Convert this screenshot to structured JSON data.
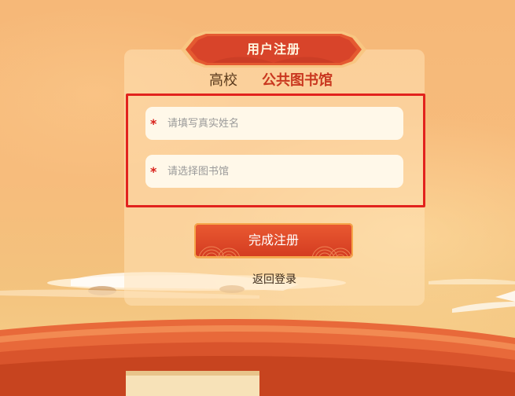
{
  "banner": {
    "title": "用户注册"
  },
  "tabs": {
    "university": "高校",
    "public_library": "公共图书馆",
    "active": "public_library"
  },
  "form": {
    "name_placeholder": "请填写真实姓名",
    "name_value": "",
    "library_placeholder": "请选择图书馆",
    "library_value": "",
    "required_mark": "*"
  },
  "actions": {
    "submit_label": "完成注册",
    "back_label": "返回登录"
  },
  "colors": {
    "accent": "#d33b20",
    "highlight_border": "#e2221d",
    "active_tab": "#c9371f"
  }
}
